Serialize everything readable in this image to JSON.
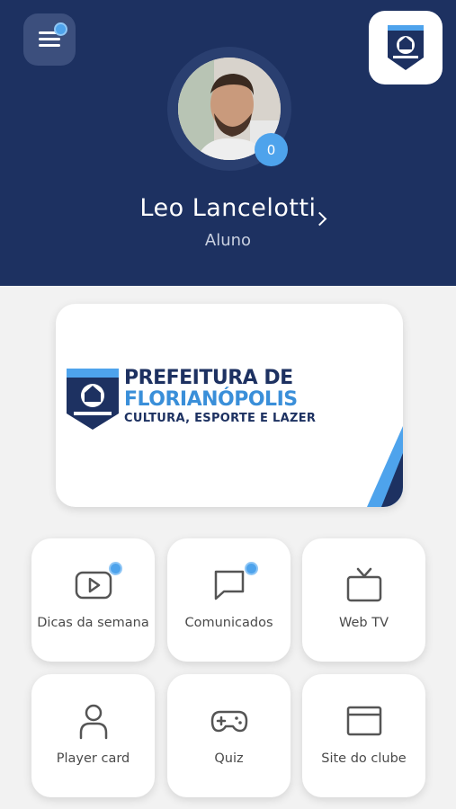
{
  "profile": {
    "name": "Leo Lancelotti",
    "role": "Aluno",
    "badge_count": "0"
  },
  "colors": {
    "header_bg": "#1d3161",
    "accent": "#4ea3ec",
    "page_bg": "#f2f2f2"
  },
  "banner": {
    "line1": "PREFEITURA DE",
    "line2": "FLORIANÓPOLIS",
    "line3": "CULTURA, ESPORTE E LAZER"
  },
  "tiles": [
    {
      "label": "Dicas da semana",
      "icon": "video-play-icon",
      "notification": true
    },
    {
      "label": "Comunicados",
      "icon": "chat-bubble-icon",
      "notification": true
    },
    {
      "label": "Web TV",
      "icon": "tv-icon",
      "notification": false
    },
    {
      "label": "Player card",
      "icon": "user-icon",
      "notification": false
    },
    {
      "label": "Quiz",
      "icon": "gamepad-icon",
      "notification": false
    },
    {
      "label": "Site do clube",
      "icon": "browser-window-icon",
      "notification": false
    }
  ]
}
